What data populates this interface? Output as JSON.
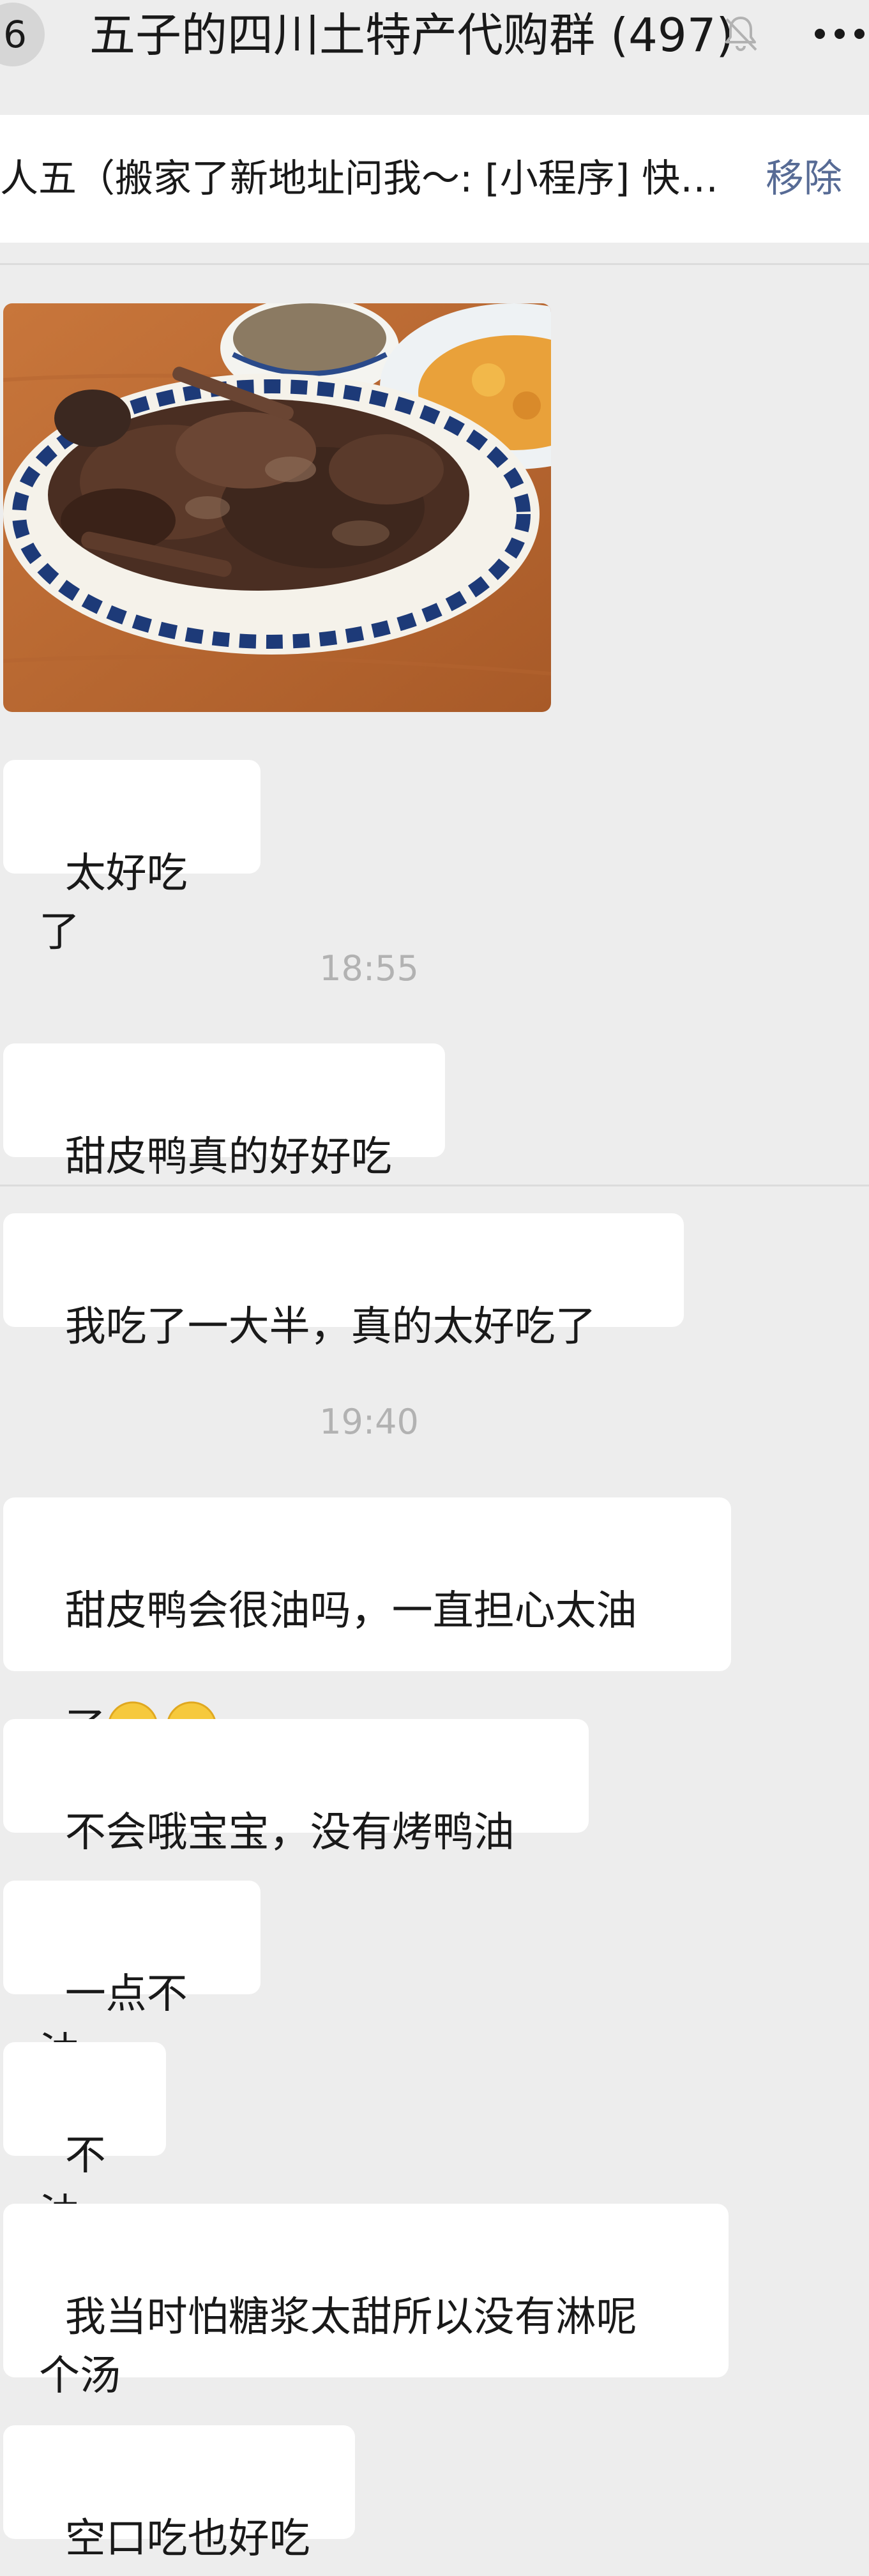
{
  "header": {
    "back_count": "6",
    "title": "五子的四川土特产代购群",
    "member_count": "(497)"
  },
  "notice": {
    "text": "人五（搬家了新地址问我～: [小程序] 快…",
    "remove_label": "移除"
  },
  "messages": [
    {
      "type": "image",
      "description": "braised-duck-photo"
    },
    {
      "type": "text",
      "text": "太好吃了"
    },
    {
      "type": "time",
      "text": "18:55"
    },
    {
      "type": "text",
      "text": "甜皮鸭真的好好吃"
    },
    {
      "type": "text",
      "text": "我吃了一大半，真的太好吃了"
    },
    {
      "type": "time",
      "text": "19:40"
    },
    {
      "type": "text",
      "text_line1": "甜皮鸭会很油吗，一直担心太油",
      "text_line2": "了",
      "emoji": "crying-face-emoji"
    },
    {
      "type": "text",
      "text": "不会哦宝宝，没有烤鸭油"
    },
    {
      "type": "text",
      "text": "一点不油"
    },
    {
      "type": "text",
      "text": "不油"
    },
    {
      "type": "text",
      "text": "我当时怕糖浆太甜所以没有淋呢\n个汤"
    },
    {
      "type": "text",
      "text": "空口吃也好吃"
    }
  ],
  "colors": {
    "background": "#ededed",
    "bubble": "#ffffff",
    "link": "#576b95",
    "timestamp": "#b2b2b2"
  }
}
